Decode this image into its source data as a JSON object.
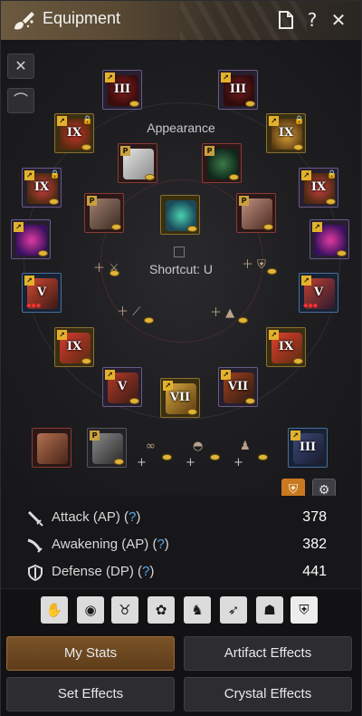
{
  "window": {
    "title": "Equipment",
    "buttons": [
      "doc-icon",
      "help-icon",
      "close-icon"
    ],
    "help_symbol": "?",
    "close_symbol": "✕"
  },
  "equipment": {
    "appearance_label": "Appearance",
    "shortcut_label": "Shortcut: U",
    "slots": [
      {
        "tier": "III",
        "style": "purple"
      },
      {
        "tier": "III",
        "style": "purple"
      },
      {
        "tier": "IX",
        "style": "gold"
      },
      {
        "tier": "IX",
        "style": "gold"
      },
      {
        "tier": "IX",
        "style": "purple"
      },
      {
        "tier": "IX",
        "style": "purple"
      },
      {
        "tier": "",
        "style": "purple"
      },
      {
        "tier": "",
        "style": "purple"
      },
      {
        "tier": "V",
        "style": "blue"
      },
      {
        "tier": "V",
        "style": "blue"
      },
      {
        "tier": "IX",
        "style": "gold"
      },
      {
        "tier": "IX",
        "style": "gold"
      },
      {
        "tier": "V",
        "style": "purple"
      },
      {
        "tier": "VII",
        "style": "gold"
      },
      {
        "tier": "VII",
        "style": "purple"
      },
      {
        "tier": "",
        "style": "gold"
      },
      {
        "tier": "",
        "style": "red"
      },
      {
        "tier": "",
        "style": "red"
      },
      {
        "tier": "",
        "style": "gray"
      },
      {
        "tier": "",
        "style": "gray"
      },
      {
        "tier": "",
        "style": "red"
      },
      {
        "tier": "",
        "style": "gray"
      },
      {
        "tier": "III",
        "style": "blue"
      }
    ]
  },
  "stats": {
    "attack": {
      "label": "Attack (AP) (",
      "q": "?",
      "close": ")",
      "value": "378"
    },
    "awakening": {
      "label": "Awakening (AP) (",
      "q": "?",
      "close": ")",
      "value": "382"
    },
    "defense": {
      "label": "Defense (DP) (",
      "q": "?",
      "close": ")",
      "value": "441"
    }
  },
  "categories": [
    "hand-grab-icon",
    "mask-icon",
    "horns-icon",
    "paw-icon",
    "knight-head-icon",
    "running-figure-icon",
    "person-icon",
    "shield-icon"
  ],
  "buttons": {
    "my_stats": "My Stats",
    "artifact_effects": "Artifact Effects",
    "set_effects": "Set Effects",
    "crystal_effects": "Crystal Effects"
  },
  "colors": {
    "accent": "#c97a20",
    "active_button": "#7a5227",
    "link_question": "#55a8e8"
  }
}
